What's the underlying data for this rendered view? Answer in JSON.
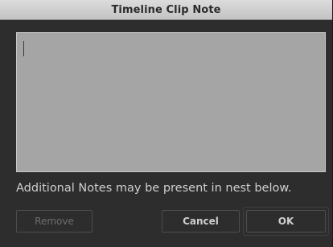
{
  "window": {
    "title": "Timeline Clip Note"
  },
  "note": {
    "value": ""
  },
  "info_text": "Additional Notes may be present in nest below.",
  "buttons": {
    "remove_label": "Remove",
    "cancel_label": "Cancel",
    "ok_label": "OK"
  },
  "colors": {
    "dialog_background": "#2d2d2d",
    "note_background": "#a5a5a5",
    "title_bar": "#d4d4d4"
  }
}
